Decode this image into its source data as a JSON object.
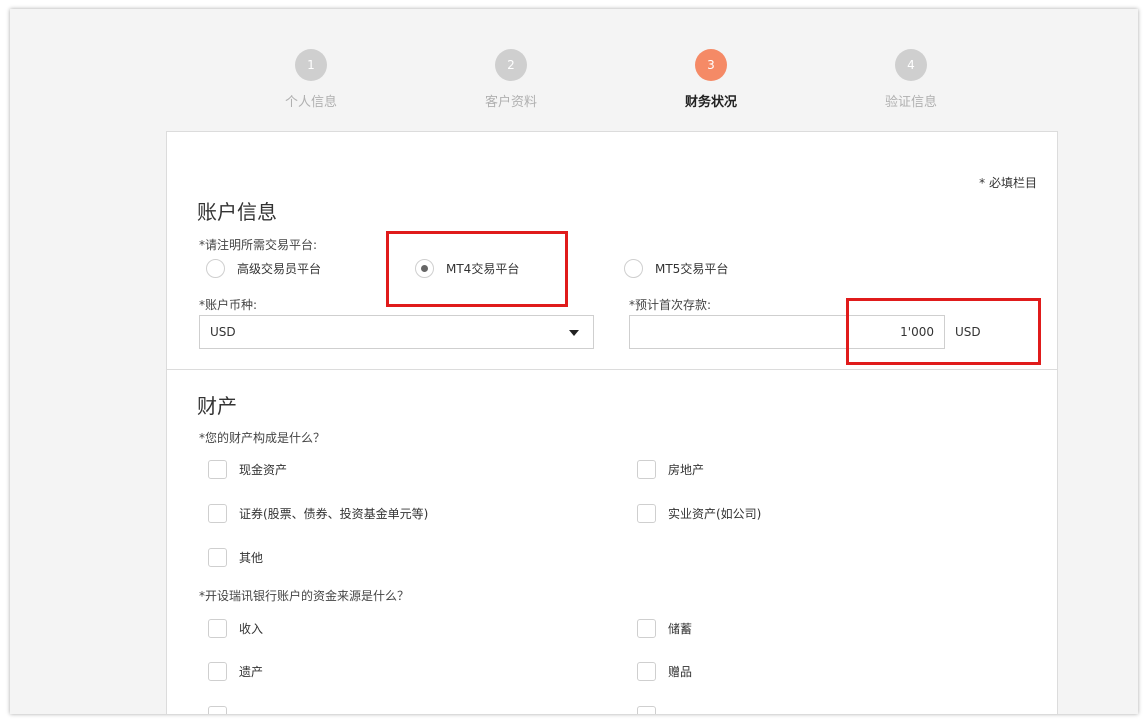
{
  "steps": [
    {
      "number": "1",
      "label": "个人信息"
    },
    {
      "number": "2",
      "label": "客户资料"
    },
    {
      "number": "3",
      "label": "财务状况"
    },
    {
      "number": "4",
      "label": "验证信息"
    }
  ],
  "required_note": "* 必填栏目",
  "account_section": {
    "title": "账户信息",
    "platform_label": "*请注明所需交易平台:",
    "platform_options": [
      "高级交易员平台",
      "MT4交易平台",
      "MT5交易平台"
    ],
    "currency_label": "*账户币种:",
    "currency_value": "USD",
    "deposit_label": "*预计首次存款:",
    "deposit_value": "1'000",
    "deposit_unit": "USD"
  },
  "assets_section": {
    "title": "财产",
    "q1_label": "*您的财产构成是什么？",
    "q1_options": [
      "现金资产",
      "房地产",
      "证券(股票、债券、投资基金单元等)",
      "实业资产(如公司)",
      "其他"
    ],
    "q2_label": "*开设瑞讯银行账户的资金来源是什么？",
    "q2_options": [
      "收入",
      "储蓄",
      "遗产",
      "赠品"
    ]
  },
  "colors": {
    "active_step": "#f58a66",
    "inactive_step": "#cfcfcf",
    "highlight": "#e01b1b"
  }
}
